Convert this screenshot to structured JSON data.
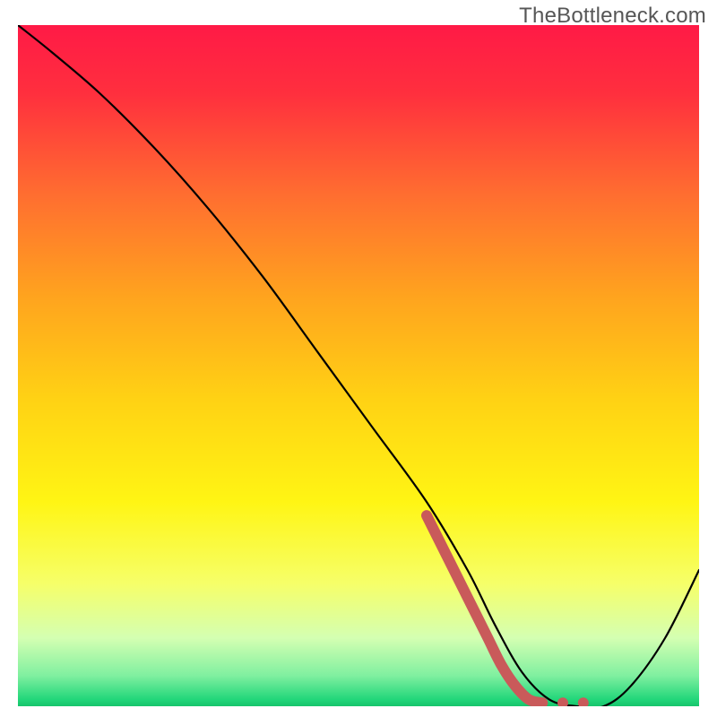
{
  "watermark": "TheBottleneck.com",
  "chart_data": {
    "type": "line",
    "title": "",
    "xlabel": "",
    "ylabel": "",
    "xlim": [
      0,
      100
    ],
    "ylim": [
      0,
      100
    ],
    "grid": false,
    "legend": false,
    "gradient_stops": [
      {
        "offset": 0.0,
        "color": "#ff1a46"
      },
      {
        "offset": 0.1,
        "color": "#ff2f3e"
      },
      {
        "offset": 0.25,
        "color": "#ff6e30"
      },
      {
        "offset": 0.4,
        "color": "#ffa41e"
      },
      {
        "offset": 0.55,
        "color": "#ffd214"
      },
      {
        "offset": 0.7,
        "color": "#fff514"
      },
      {
        "offset": 0.82,
        "color": "#f6ff69"
      },
      {
        "offset": 0.9,
        "color": "#d4ffb2"
      },
      {
        "offset": 0.955,
        "color": "#80f0a0"
      },
      {
        "offset": 0.99,
        "color": "#22d67a"
      },
      {
        "offset": 1.0,
        "color": "#17c46c"
      }
    ],
    "series": [
      {
        "name": "bottleneck-curve",
        "x": [
          0,
          5,
          12,
          20,
          28,
          36,
          44,
          52,
          60,
          66,
          70,
          74,
          78,
          82,
          86,
          90,
          95,
          100
        ],
        "y": [
          100,
          96,
          90,
          82,
          73,
          63,
          52,
          41,
          30,
          20,
          12,
          5,
          1,
          0,
          0,
          3,
          10,
          20
        ]
      }
    ],
    "highlight": {
      "color": "#c95a5a",
      "x": [
        60,
        63,
        66,
        69,
        71,
        73,
        75,
        77,
        80,
        83
      ],
      "y": [
        28,
        22,
        16,
        10,
        6,
        3,
        1,
        0.5,
        0.5,
        0.5
      ],
      "style": [
        "line",
        "line",
        "line",
        "line",
        "line",
        "line",
        "line",
        "dot",
        "dot",
        "dot"
      ]
    }
  }
}
